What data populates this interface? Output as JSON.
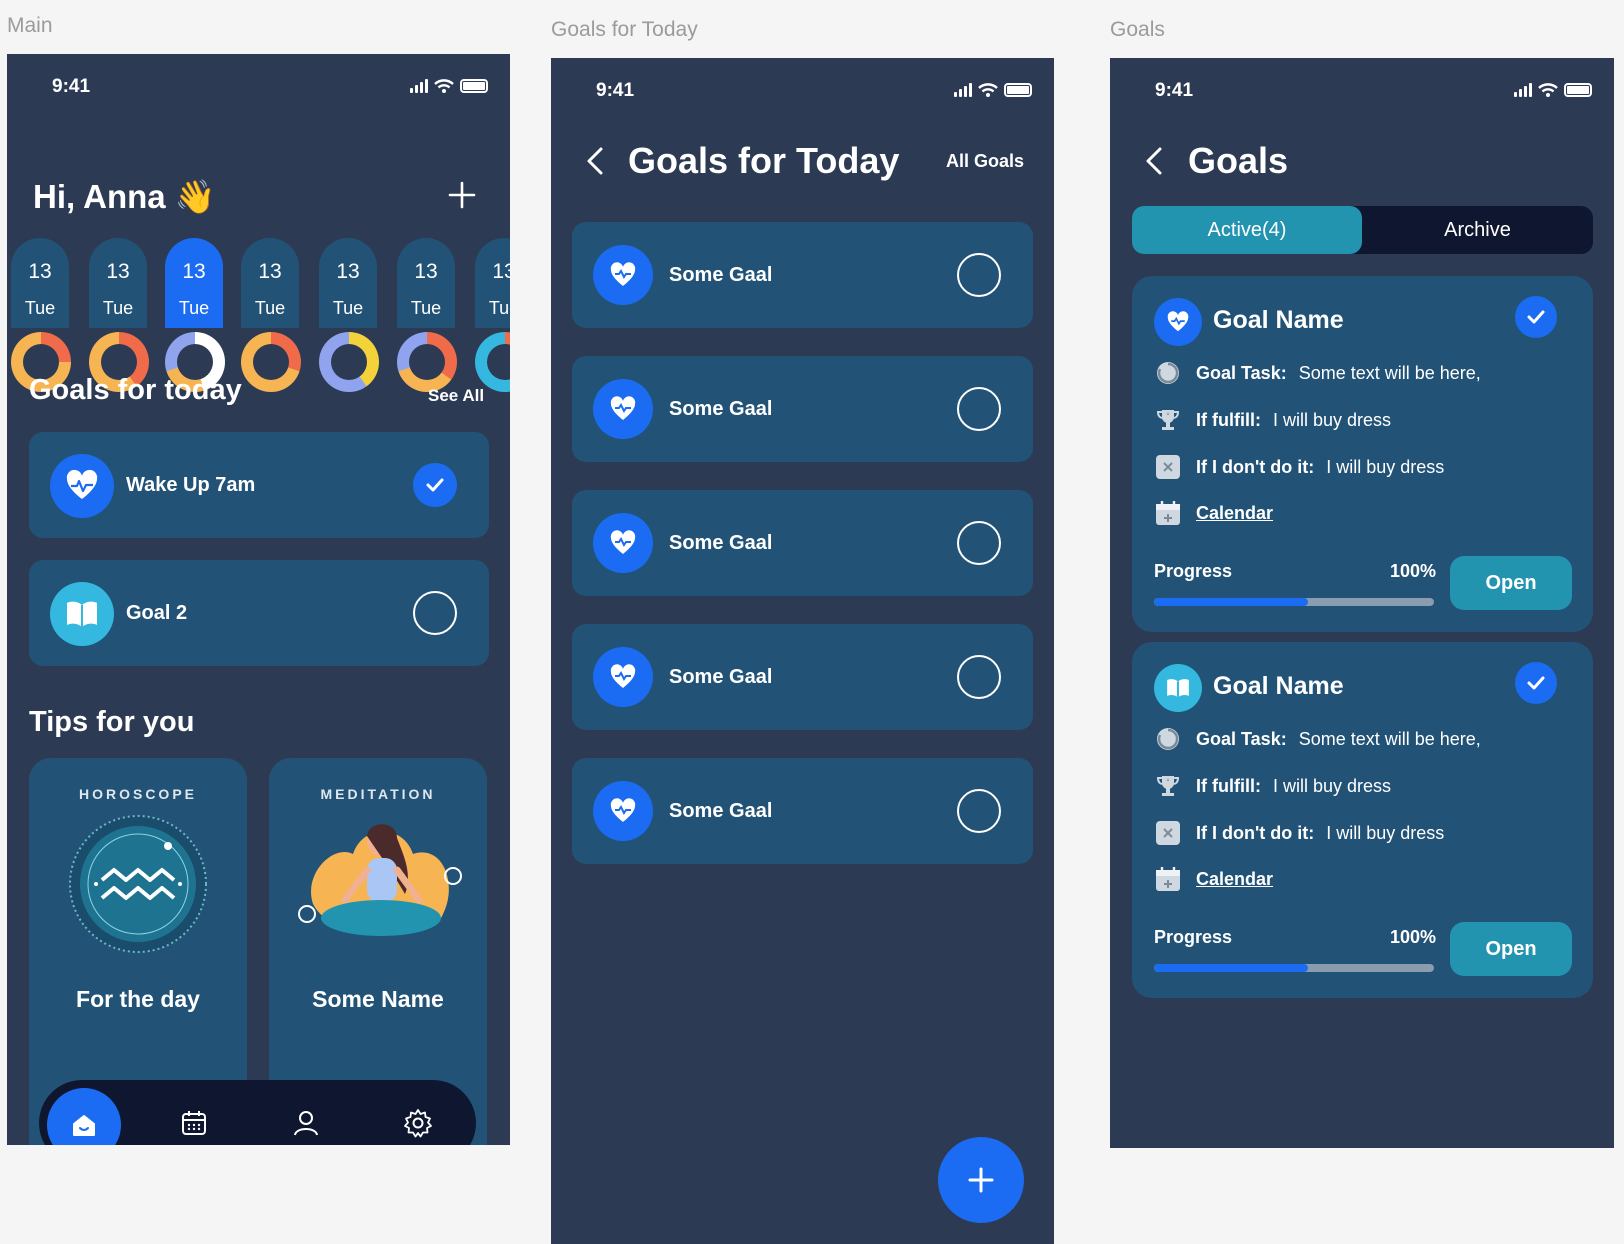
{
  "frames": {
    "main": "Main",
    "today": "Goals for Today",
    "goals": "Goals"
  },
  "status": {
    "time": "9:41"
  },
  "main": {
    "greeting": "Hi, Anna",
    "wave": "👋",
    "days": [
      {
        "num": "13",
        "day": "Tue"
      },
      {
        "num": "13",
        "day": "Tue"
      },
      {
        "num": "13",
        "day": "Tue"
      },
      {
        "num": "13",
        "day": "Tue"
      },
      {
        "num": "13",
        "day": "Tue"
      },
      {
        "num": "13",
        "day": "Tue"
      },
      {
        "num": "13",
        "day": "Tue"
      }
    ],
    "goals_title": "Goals for today",
    "see_all": "See All",
    "goals": [
      {
        "name": "Wake Up 7am",
        "done": true
      },
      {
        "name": "Goal 2",
        "done": false
      }
    ],
    "tips_title": "Tips  for you",
    "tips": [
      {
        "category": "HOROSCOPE",
        "caption": "For the day"
      },
      {
        "category": "MEDITATION",
        "caption": "Some Name"
      }
    ]
  },
  "today": {
    "title": "Goals for Today",
    "all_goals": "All Goals",
    "items": [
      "Some Gaal",
      "Some Gaal",
      "Some Gaal",
      "Some Gaal",
      "Some Gaal"
    ]
  },
  "goals": {
    "title": "Goals",
    "tab_active": "Active(4)",
    "tab_archive": "Archive",
    "cards": [
      {
        "name": "Goal Name",
        "task_label": "Goal Task:",
        "task": "Some text will be here,",
        "fulfill_label": "If fulfill:",
        "fulfill": "I will buy dress",
        "fail_label": "If I don't do it:",
        "fail": "I will buy dress",
        "calendar": "Calendar",
        "progress_label": "Progress",
        "progress_value": "100%",
        "progress_fraction": 0.55,
        "open": "Open"
      },
      {
        "name": "Goal Name",
        "task_label": "Goal Task:",
        "task": "Some text will be here,",
        "fulfill_label": "If fulfill:",
        "fulfill": "I will buy dress",
        "fail_label": "If I don't do it:",
        "fail": "I will buy dress",
        "calendar": "Calendar",
        "progress_label": "Progress",
        "progress_value": "100%",
        "progress_fraction": 0.55,
        "open": "Open"
      }
    ]
  },
  "colors": {
    "bg": "#2d3a54",
    "card": "#225377",
    "accent": "#1b6cf2",
    "teal": "#2394b0",
    "nav": "#0f1630"
  }
}
